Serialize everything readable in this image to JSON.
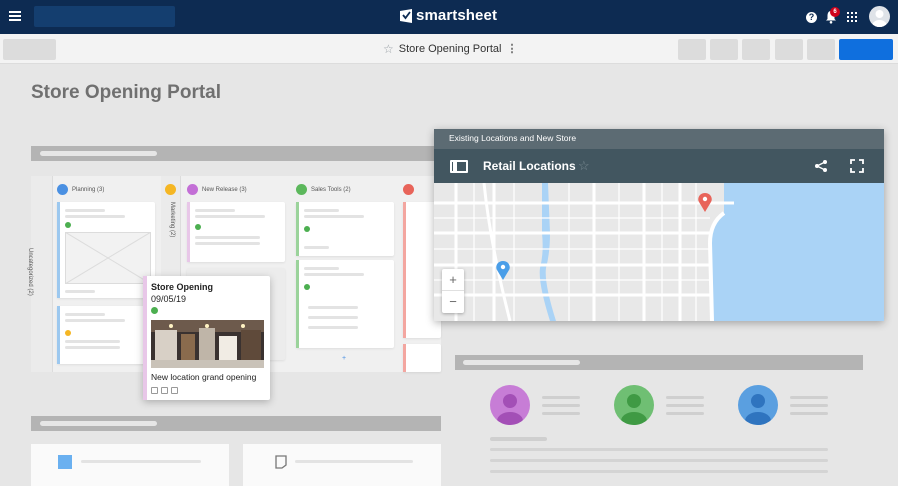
{
  "app": {
    "brand": "smartsheet"
  },
  "topnav": {
    "notification_count": "6",
    "icons": [
      "menu-icon",
      "help-icon",
      "bell-icon",
      "apps-icon",
      "avatar"
    ]
  },
  "toolbar": {
    "title": "Store Opening Portal"
  },
  "dashboard": {
    "title": "Store Opening Portal"
  },
  "card_view": {
    "lanes": [
      {
        "label": "Planning (3)",
        "color": "#4a90e2"
      },
      {
        "label": "New Release (3)",
        "color": "#c36fd6"
      },
      {
        "label": "Sales Tools (2)",
        "color": "#5cb85c"
      }
    ],
    "side_lanes": [
      {
        "label": "Uncategorized (2)"
      },
      {
        "label": "Marketing (2)"
      }
    ]
  },
  "floating_card": {
    "title": "Store Opening",
    "date": "09/05/19",
    "caption": "New location grand opening",
    "status_color": "#4caf50"
  },
  "map_widget": {
    "header": "Existing Locations and New Store",
    "title": "Retail Locations",
    "zoom_in": "+",
    "zoom_out": "−"
  },
  "contacts": {
    "avatar_colors": [
      "#c77dd6",
      "#6fbf73",
      "#5a9fe0"
    ]
  }
}
